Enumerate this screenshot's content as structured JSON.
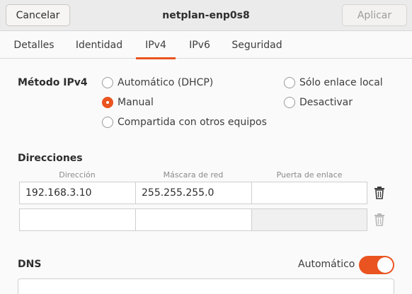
{
  "header": {
    "cancel_label": "Cancelar",
    "title": "netplan-enp0s8",
    "apply_label": "Aplicar"
  },
  "tabs": [
    {
      "label": "Detalles"
    },
    {
      "label": "Identidad"
    },
    {
      "label": "IPv4",
      "active": true
    },
    {
      "label": "IPv6"
    },
    {
      "label": "Seguridad"
    }
  ],
  "ipv4": {
    "method_label": "Método IPv4",
    "options": {
      "auto_dhcp": "Automático (DHCP)",
      "link_local": "Sólo enlace local",
      "manual": "Manual",
      "disable": "Desactivar",
      "shared": "Compartida con otros equipos"
    },
    "selected": "manual"
  },
  "addresses": {
    "section_label": "Direcciones",
    "columns": [
      "Dirección",
      "Máscara de red",
      "Puerta de enlace"
    ],
    "rows": [
      {
        "address": "192.168.3.10",
        "netmask": "255.255.255.0",
        "gateway": ""
      },
      {
        "address": "",
        "netmask": "",
        "gateway": ""
      }
    ]
  },
  "dns": {
    "section_label": "DNS",
    "auto_label": "Automático",
    "auto_enabled": true
  },
  "colors": {
    "accent": "#e95420"
  },
  "icons": [
    "trash-icon"
  ]
}
